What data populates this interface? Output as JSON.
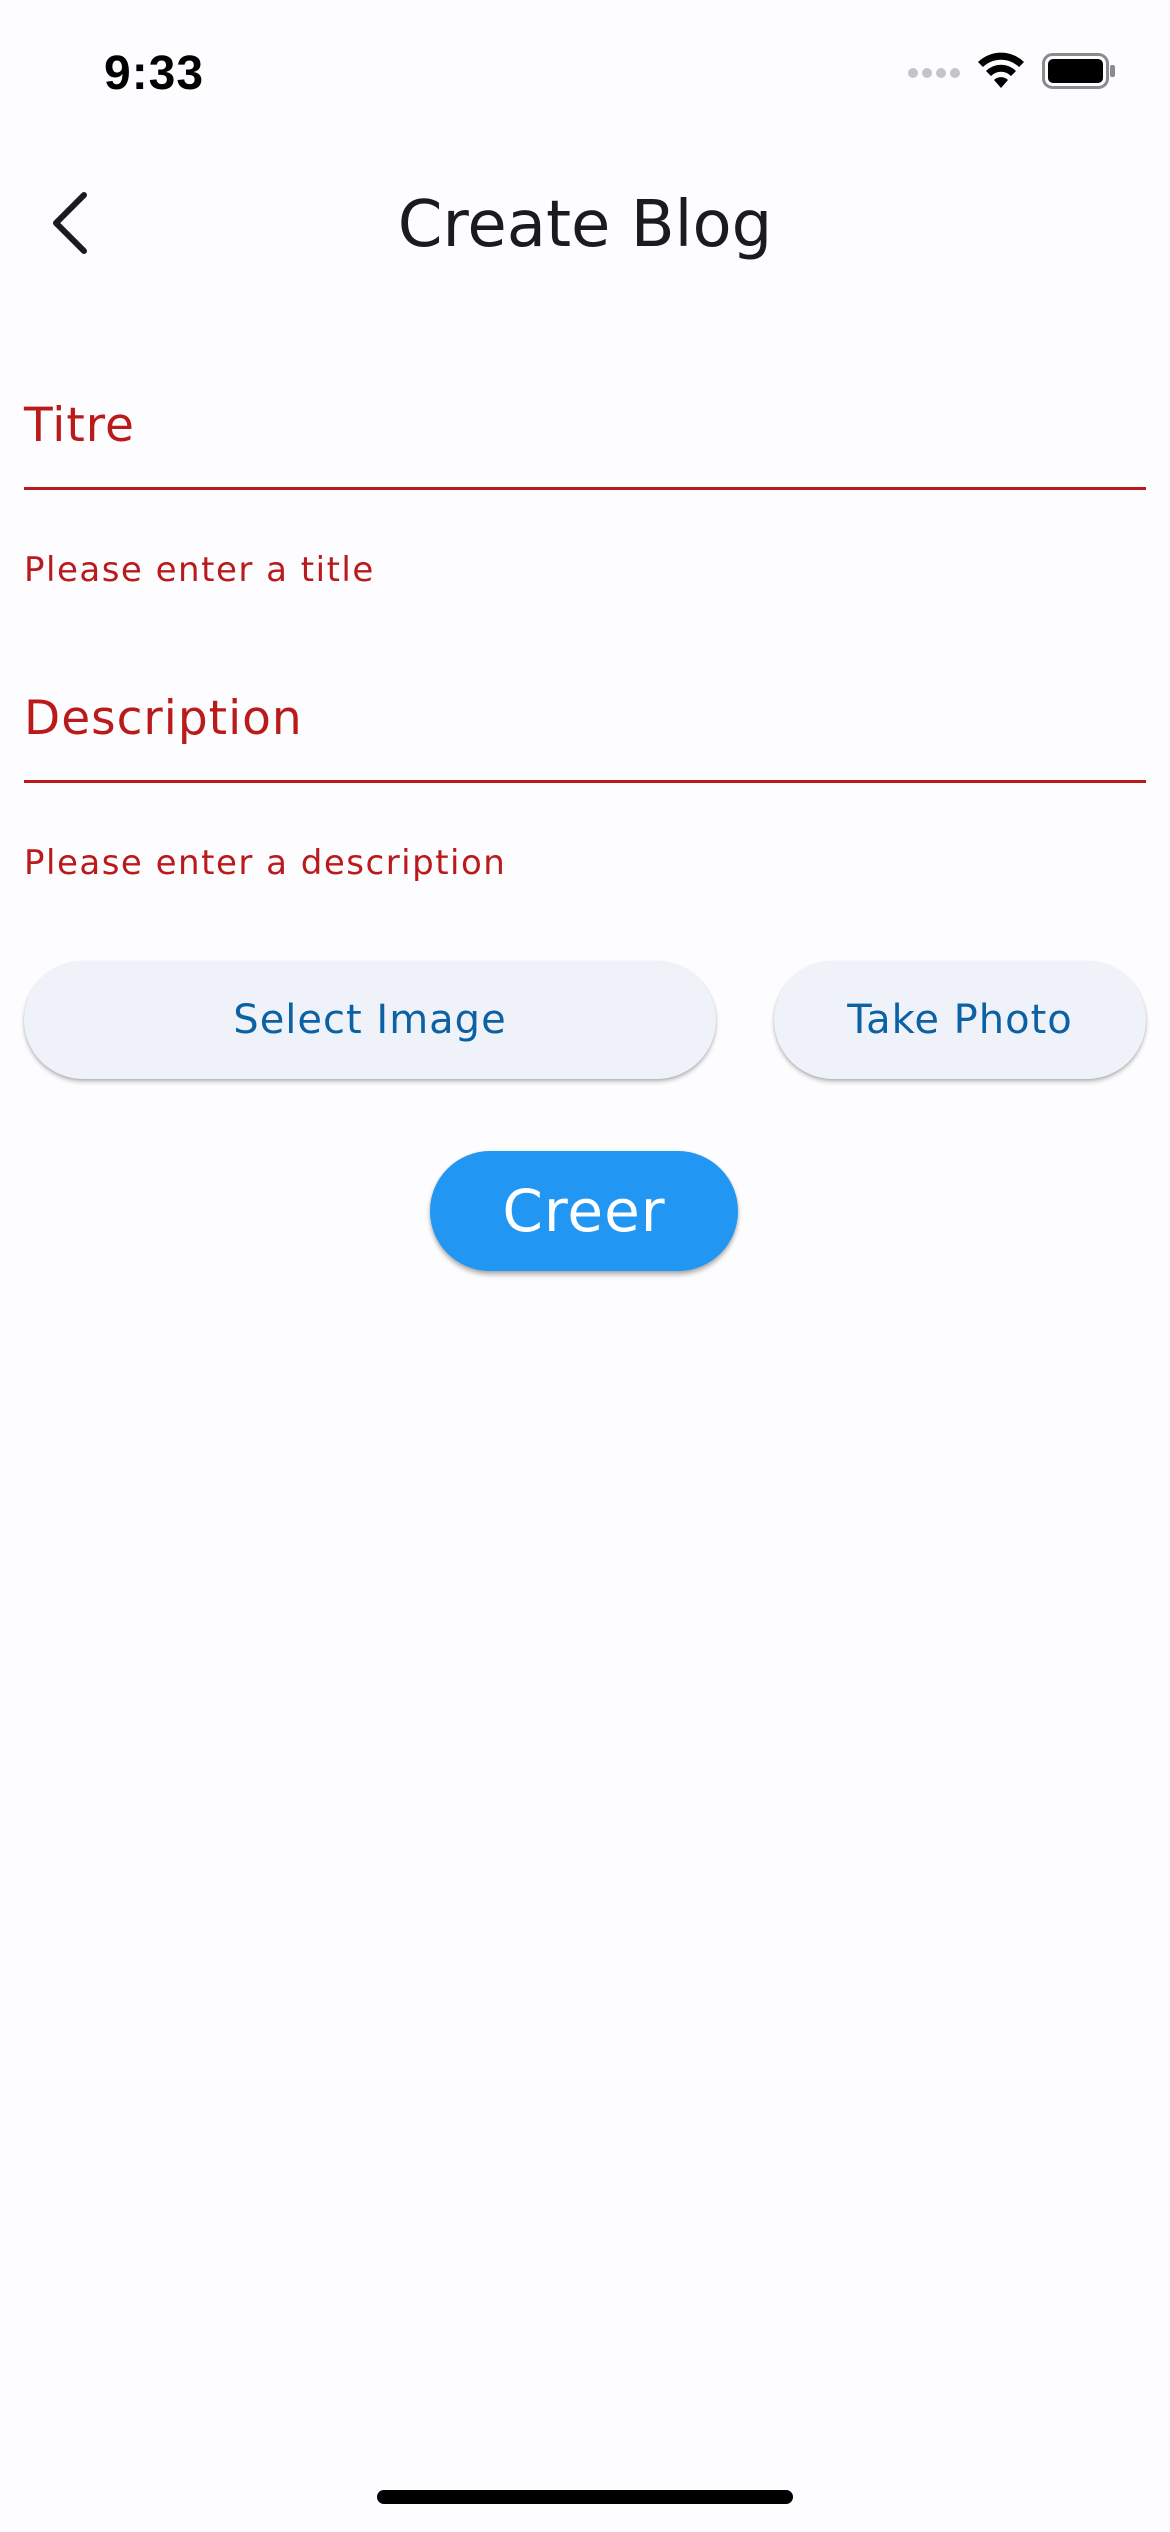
{
  "status_bar": {
    "time": "9:33"
  },
  "header": {
    "title": "Create Blog",
    "back_icon": "chevron-left-icon"
  },
  "form": {
    "title_field": {
      "label": "Titre",
      "value": "",
      "error": "Please enter a title"
    },
    "description_field": {
      "label": "Description",
      "value": "",
      "error": "Please enter a description"
    }
  },
  "actions": {
    "select_image_label": "Select Image",
    "take_photo_label": "Take Photo",
    "create_label": "Creer"
  },
  "colors": {
    "error": "#ba1a1a",
    "tonal_button_bg": "#eff2f9",
    "tonal_button_text": "#0b61a4",
    "primary": "#2196f3",
    "background": "#fdfcff"
  }
}
